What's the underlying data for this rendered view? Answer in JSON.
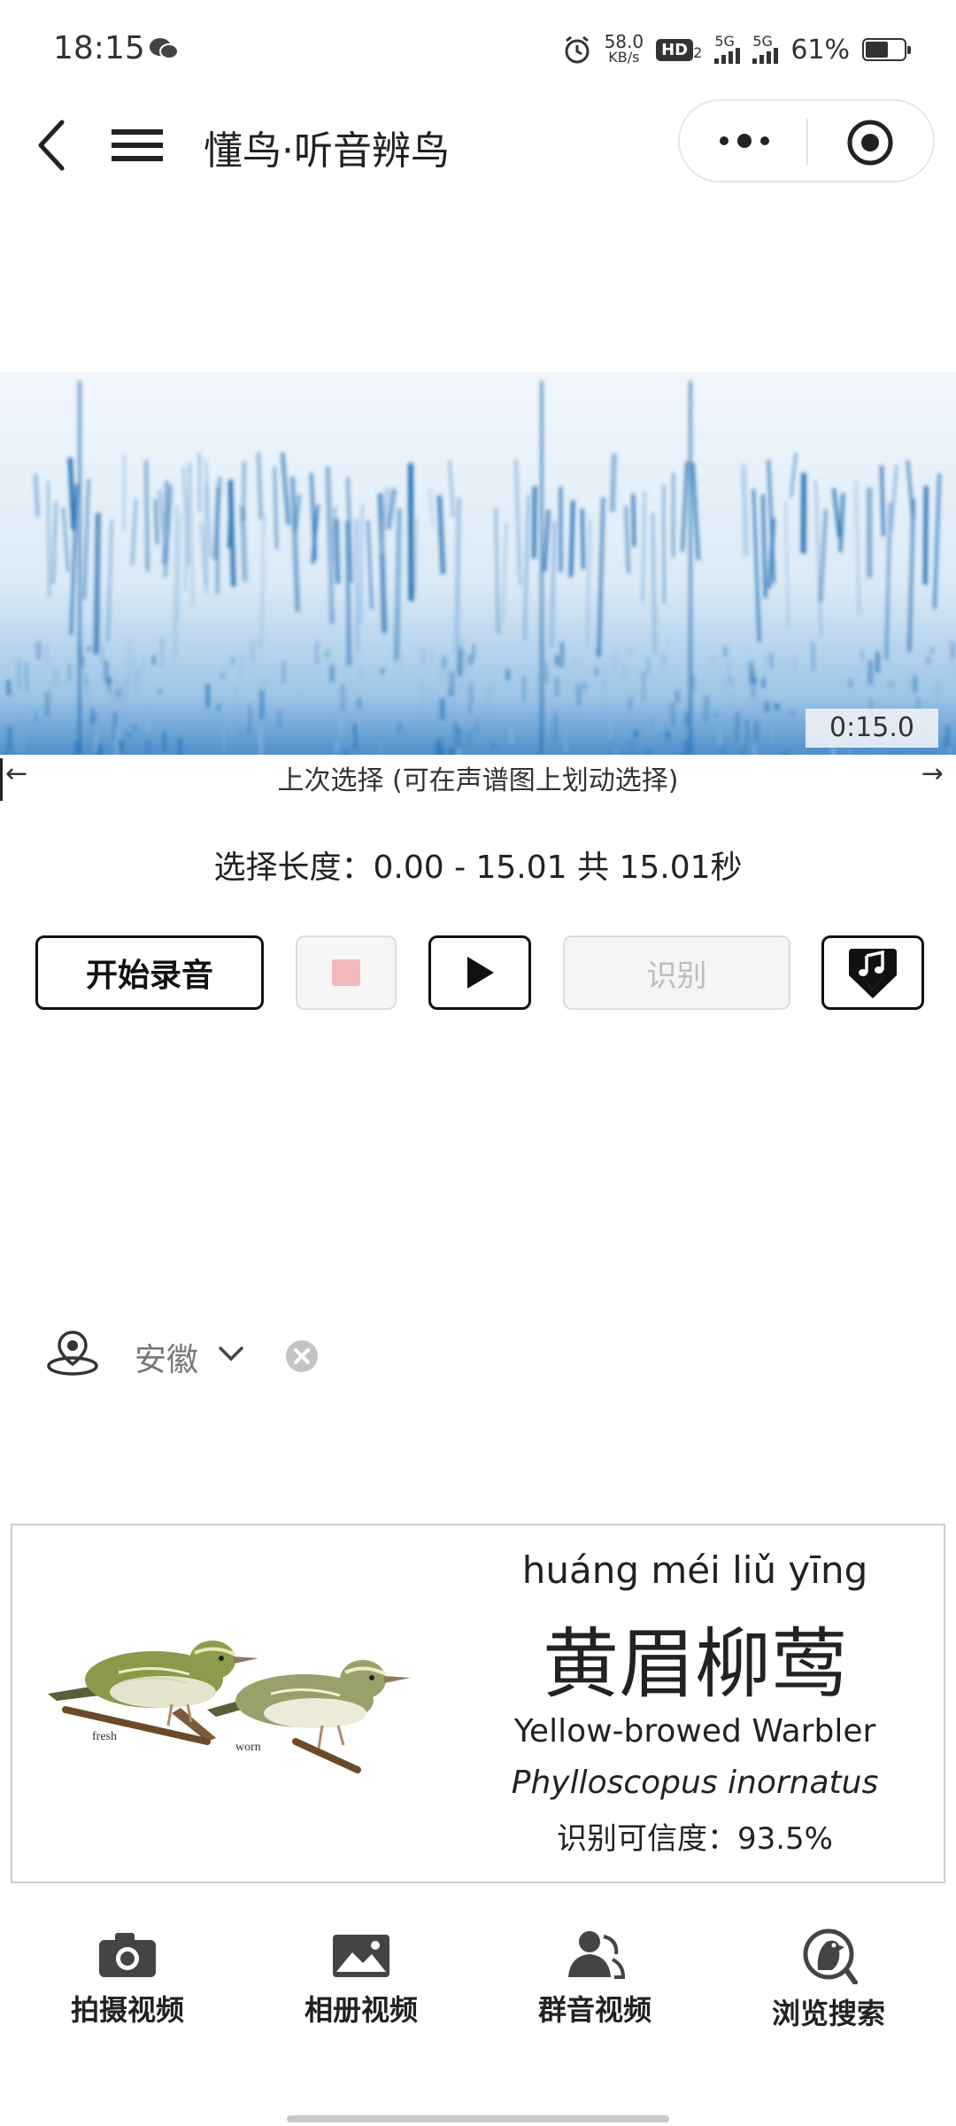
{
  "status_bar": {
    "time": "18:15",
    "net_speed": "58.0",
    "net_speed_unit": "KB/s",
    "hd_label": "HD",
    "hd_sub": "2",
    "signal1": "5G",
    "signal2": "5G",
    "battery": "61%",
    "battery_level": 0.61
  },
  "nav": {
    "title": "懂鸟·听音辨鸟"
  },
  "spectrogram": {
    "duration": "0:15.0",
    "left_arrow": "←",
    "right_arrow": "→",
    "hint": "上次选择 (可在声谱图上划动选择)",
    "colors": {
      "bg": "#eef4fb",
      "mid": "#8cb8e0",
      "dark": "#1d6bb1"
    }
  },
  "selection": {
    "text": "选择长度：0.00 - 15.01 共 15.01秒"
  },
  "controls": {
    "record_label": "开始录音",
    "identify_label": "识别",
    "icons": [
      "stop-icon",
      "play-icon",
      "music-download-icon"
    ]
  },
  "location": {
    "region": "安徽"
  },
  "result": {
    "pinyin": "huáng méi liǔ yīng",
    "cn_name": "黄眉柳莺",
    "en_name": "Yellow-browed Warbler",
    "latin": "Phylloscopus inornatus",
    "confidence": "识别可信度：93.5%",
    "illustration_labels": {
      "fresh": "fresh",
      "worn": "worn"
    }
  },
  "bottom_nav": {
    "items": [
      {
        "label": "拍摄视频",
        "icon": "camera-icon"
      },
      {
        "label": "相册视频",
        "icon": "image-icon"
      },
      {
        "label": "群音视频",
        "icon": "group-icon"
      },
      {
        "label": "浏览搜索",
        "icon": "bird-search-icon"
      }
    ]
  }
}
